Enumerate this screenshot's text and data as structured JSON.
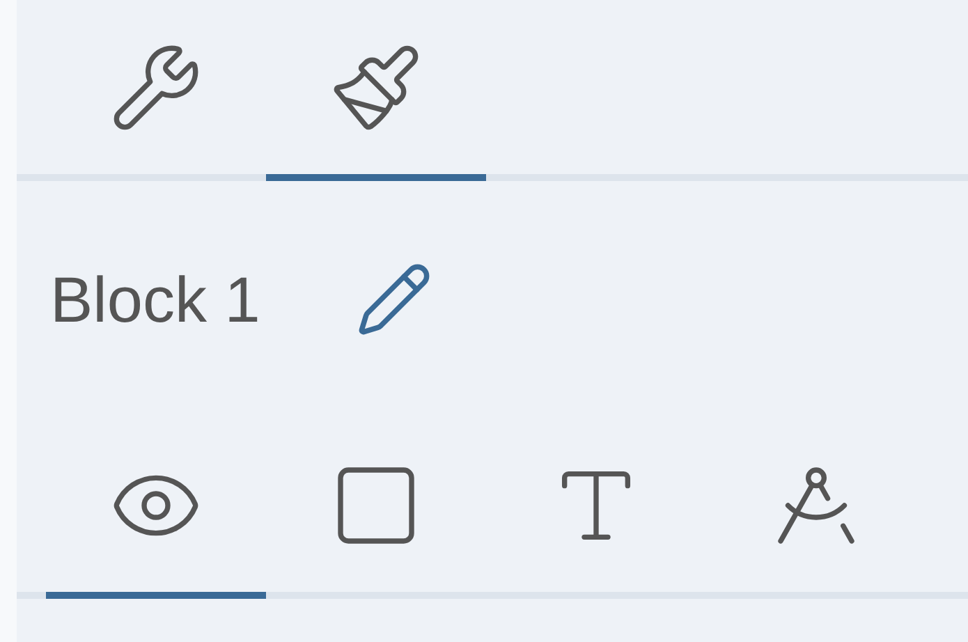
{
  "top_tabs": [
    {
      "kind": "tools",
      "selected": false
    },
    {
      "kind": "style",
      "selected": true
    }
  ],
  "block": {
    "name": "Block 1"
  },
  "view_tabs": [
    {
      "kind": "visibility",
      "selected": true
    },
    {
      "kind": "shape",
      "selected": false
    },
    {
      "kind": "text",
      "selected": false
    },
    {
      "kind": "geometry",
      "selected": false
    }
  ]
}
